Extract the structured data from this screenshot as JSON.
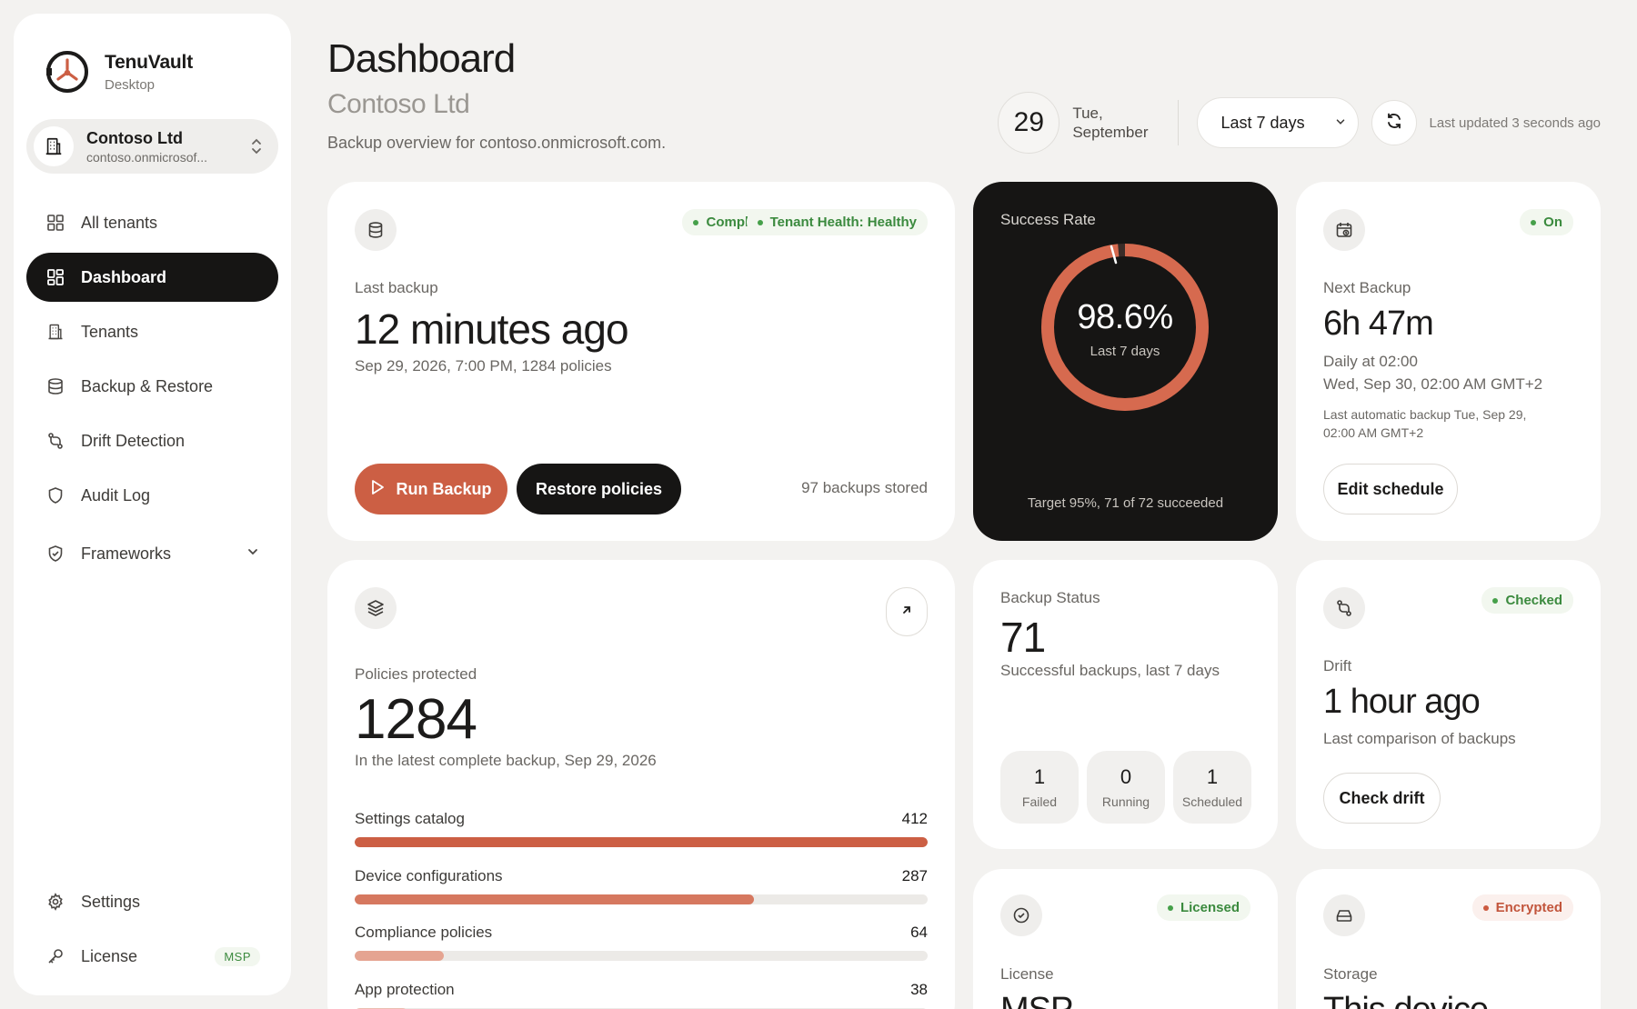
{
  "app": {
    "name": "TenuVault",
    "subtitle": "Desktop"
  },
  "tenant": {
    "name": "Contoso Ltd",
    "domain": "contoso.onmicrosof..."
  },
  "nav": {
    "items": [
      {
        "label": "All tenants",
        "icon": "grid-icon"
      },
      {
        "label": "Dashboard",
        "icon": "dashboard-icon",
        "active": true
      },
      {
        "label": "Tenants",
        "icon": "building-icon"
      },
      {
        "label": "Backup & Restore",
        "icon": "database-icon"
      },
      {
        "label": "Drift Detection",
        "icon": "git-compare-icon"
      },
      {
        "label": "Audit Log",
        "icon": "shield-icon"
      },
      {
        "label": "Frameworks",
        "icon": "shield-check-icon"
      }
    ],
    "settings": "Settings",
    "license": "License",
    "license_badge": "MSP"
  },
  "header": {
    "title": "Dashboard",
    "subtitle": "Contoso Ltd",
    "description": "Backup overview for contoso.onmicrosoft.com.",
    "date_day": "29",
    "date_weekday": "Tue,",
    "date_month": "September",
    "range": "Last 7 days",
    "updated": "Last updated 3 seconds ago"
  },
  "last_backup": {
    "status": "Completed",
    "health": "Tenant Health: Healthy",
    "label": "Last backup",
    "value": "12 minutes ago",
    "details": "Sep 29, 2026, 7:00 PM, 1284 policies",
    "run_label": "Run Backup",
    "restore_label": "Restore policies",
    "stored": "97 backups stored"
  },
  "success_rate": {
    "title": "Success Rate",
    "value": "98.6%",
    "period": "Last 7 days",
    "rate": 0.986,
    "footer": "Target 95%, 71 of 72 succeeded"
  },
  "next_backup": {
    "badge": "On",
    "label": "Next Backup",
    "value": "6h 47m",
    "schedule": "Daily at 02:00",
    "next": "Wed, Sep 30, 02:00 AM GMT+2",
    "last_auto_1": "Last automatic backup Tue, Sep 29,",
    "last_auto_2": "02:00 AM GMT+2",
    "button": "Edit schedule"
  },
  "policies": {
    "label": "Policies protected",
    "value": "1284",
    "details": "In the latest complete backup, Sep 29, 2026",
    "max": 412,
    "categories": [
      {
        "name": "Settings catalog",
        "count": 412,
        "color": "#cc5f44"
      },
      {
        "name": "Device configurations",
        "count": 287,
        "color": "#d6785f"
      },
      {
        "name": "Compliance policies",
        "count": 64,
        "color": "#e5a491"
      },
      {
        "name": "App protection",
        "count": 38,
        "color": "#ecbdb0"
      }
    ]
  },
  "backup_status": {
    "label": "Backup Status",
    "value": "71",
    "details": "Successful backups, last 7 days",
    "stats": [
      {
        "n": "1",
        "t": "Failed"
      },
      {
        "n": "0",
        "t": "Running"
      },
      {
        "n": "1",
        "t": "Scheduled"
      }
    ]
  },
  "drift": {
    "badge": "Checked",
    "label": "Drift",
    "value": "1 hour ago",
    "details": "Last comparison of backups",
    "button": "Check drift"
  },
  "license_card": {
    "badge": "Licensed",
    "label": "License",
    "value": "MSP"
  },
  "storage_card": {
    "badge": "Encrypted",
    "label": "Storage",
    "value": "This device"
  },
  "colors": {
    "accent": "#cc5f44",
    "dark": "#161514",
    "success": "#3b8a3e"
  }
}
